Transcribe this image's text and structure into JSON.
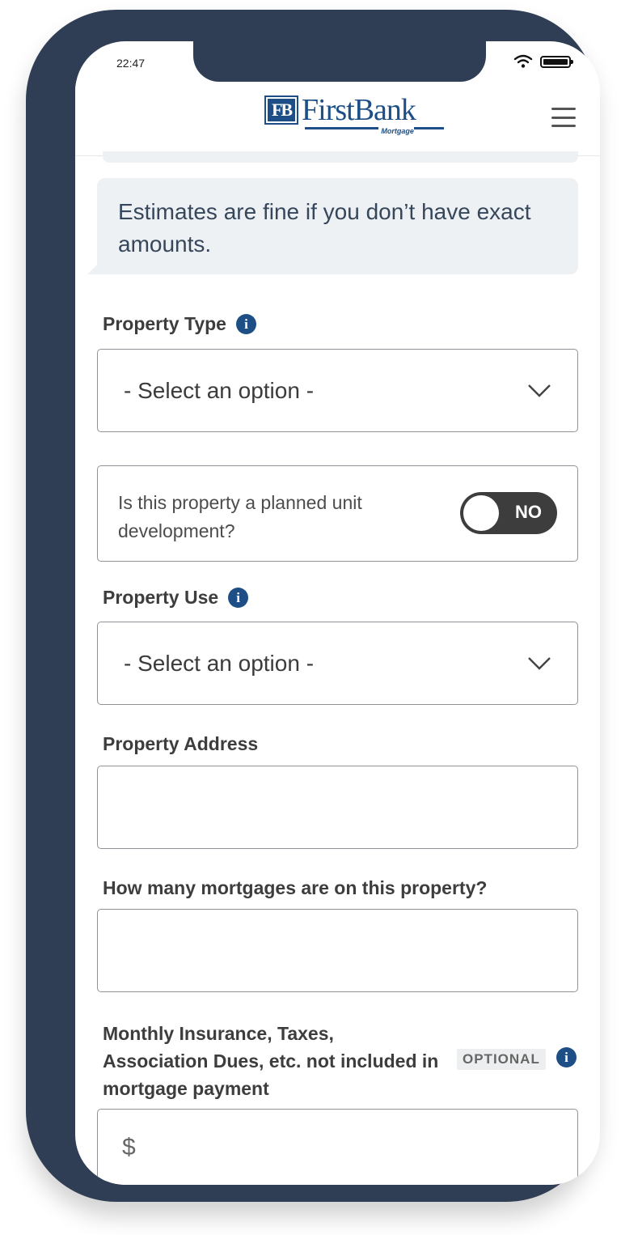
{
  "status_bar": {
    "time": "22:47",
    "wifi_icon": "wifi-icon",
    "battery_icon": "battery-icon"
  },
  "header": {
    "logo_mark": "FB",
    "logo_name": "FirstBank",
    "logo_sub": "Mortgage",
    "menu_icon": "hamburger-menu-icon",
    "brand_color": "#1d4f86"
  },
  "chat": {
    "message": "Estimates are fine if you don’t have exact amounts."
  },
  "form": {
    "property_type": {
      "label": "Property Type",
      "placeholder": "- Select an option -"
    },
    "planned_unit": {
      "question": "Is this property a planned unit development?",
      "toggle_label": "NO"
    },
    "property_use": {
      "label": "Property Use",
      "placeholder": "- Select an option -"
    },
    "property_address": {
      "label": "Property Address",
      "value": ""
    },
    "mortgages_count": {
      "label": "How many mortgages are on this property?",
      "value": ""
    },
    "monthly_costs": {
      "label": "Monthly Insurance, Taxes, Association Dues, etc. not included in mortgage payment",
      "badge": "OPTIONAL",
      "prefix": "$"
    }
  }
}
